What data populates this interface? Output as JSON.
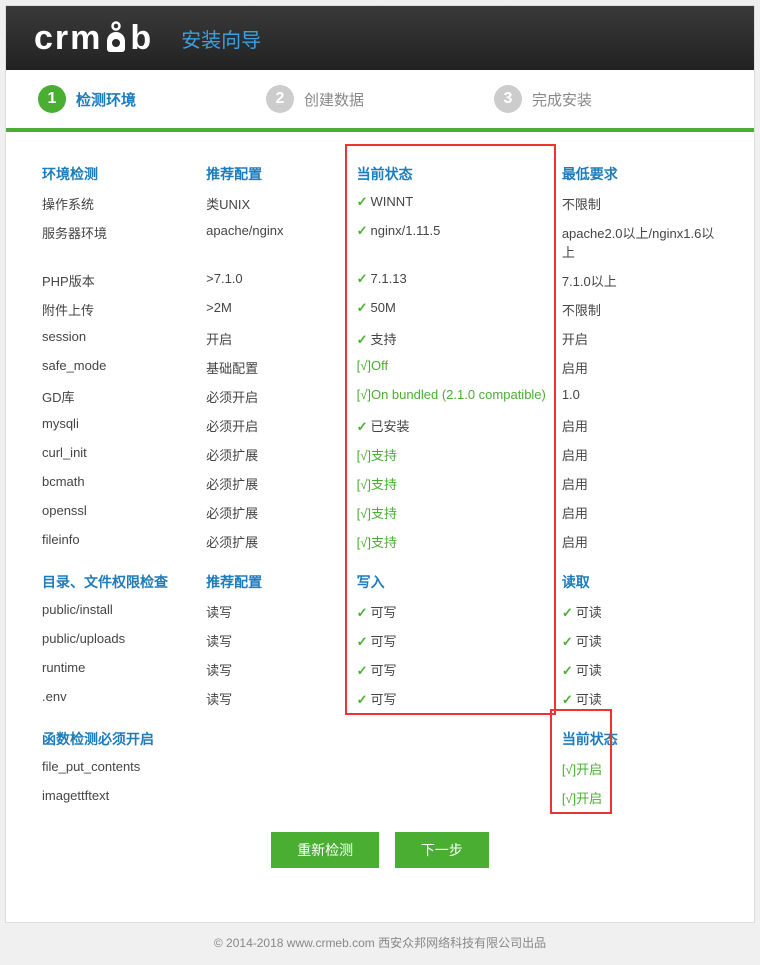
{
  "logo_text_left": "crm",
  "logo_text_right": "b",
  "title": "安装向导",
  "steps": [
    {
      "num": "1",
      "label": "检测环境"
    },
    {
      "num": "2",
      "label": "创建数据"
    },
    {
      "num": "3",
      "label": "完成安装"
    }
  ],
  "headers": {
    "env": "环境检测",
    "rec": "推荐配置",
    "status": "当前状态",
    "min": "最低要求",
    "dir": "目录、文件权限检查",
    "write": "写入",
    "read": "读取",
    "func": "函数检测必须开启"
  },
  "env_rows": [
    {
      "k": "操作系统",
      "r": "类UNIX",
      "s": "WINNT",
      "st": "check",
      "m": "不限制"
    },
    {
      "k": "服务器环境",
      "r": "apache/nginx",
      "s": "nginx/1.11.5",
      "st": "check",
      "m": "apache2.0以上/nginx1.6以上"
    },
    {
      "k": "PHP版本",
      "r": ">7.1.0",
      "s": "7.1.13",
      "st": "check",
      "m": "7.1.0以上"
    },
    {
      "k": "附件上传",
      "r": ">2M",
      "s": "50M",
      "st": "check",
      "m": "不限制"
    },
    {
      "k": "session",
      "r": "开启",
      "s": "支持",
      "st": "check",
      "m": "开启"
    },
    {
      "k": "safe_mode",
      "r": "基础配置",
      "s": "[√]Off",
      "st": "text",
      "m": "启用"
    },
    {
      "k": "GD库",
      "r": "必须开启",
      "s": "[√]On bundled (2.1.0 compatible)",
      "st": "text",
      "m": "1.0"
    },
    {
      "k": "mysqli",
      "r": "必须开启",
      "s": "已安装",
      "st": "check",
      "m": "启用"
    },
    {
      "k": "curl_init",
      "r": "必须扩展",
      "s": "[√]支持",
      "st": "text",
      "m": "启用"
    },
    {
      "k": "bcmath",
      "r": "必须扩展",
      "s": "[√]支持",
      "st": "text",
      "m": "启用"
    },
    {
      "k": "openssl",
      "r": "必须扩展",
      "s": "[√]支持",
      "st": "text",
      "m": "启用"
    },
    {
      "k": "fileinfo",
      "r": "必须扩展",
      "s": "[√]支持",
      "st": "text",
      "m": "启用"
    }
  ],
  "dir_rows": [
    {
      "k": "public/install",
      "r": "读写",
      "w": "可写",
      "rd": "可读"
    },
    {
      "k": "public/uploads",
      "r": "读写",
      "w": "可写",
      "rd": "可读"
    },
    {
      "k": "runtime",
      "r": "读写",
      "w": "可写",
      "rd": "可读"
    },
    {
      "k": ".env",
      "r": "读写",
      "w": "可写",
      "rd": "可读"
    }
  ],
  "func_rows": [
    {
      "k": "file_put_contents",
      "s": "[√]开启"
    },
    {
      "k": "imagettftext",
      "s": "[√]开启"
    }
  ],
  "buttons": {
    "recheck": "重新检测",
    "next": "下一步"
  },
  "footer": "© 2014-2018 www.crmeb.com 西安众邦网络科技有限公司出品"
}
